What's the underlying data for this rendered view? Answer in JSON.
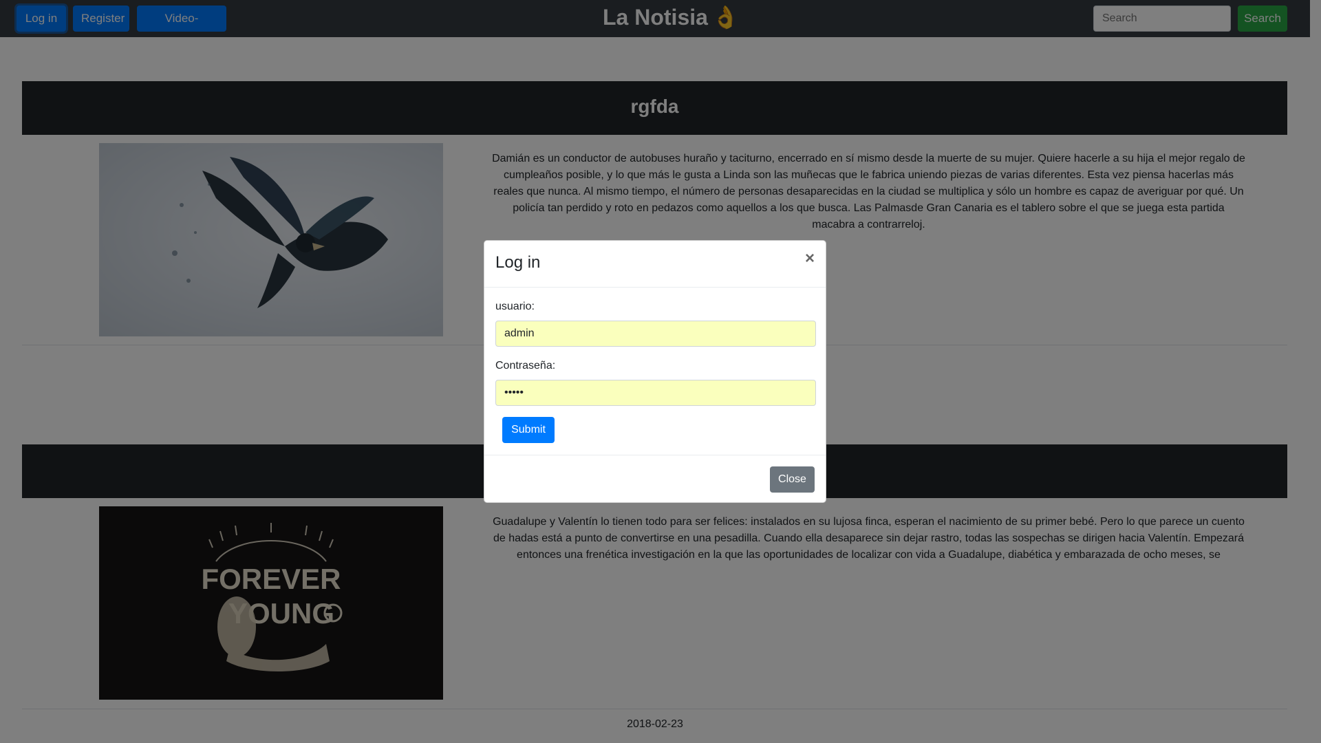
{
  "navbar": {
    "login_label": "Log in",
    "register_label": "Register",
    "video_label": "Video-Noticias",
    "brand": "La Notisia",
    "brand_emoji": "👌",
    "search_placeholder": "Search",
    "search_button": "Search"
  },
  "articles": [
    {
      "title": "rgfda",
      "image": "eagle-image",
      "text": "Damián es un conductor de autobuses huraño y taciturno, encerrado en sí mismo desde la muerte de su mujer. Quiere hacerle a su hija el mejor regalo de cumpleaños posible, y lo que más le gusta a Linda son las muñecas que le fabrica uniendo piezas de varias diferentes. Esta vez piensa hacerlas más reales que nunca. Al mismo tiempo, el número de personas desaparecidas en la ciudad se multiplica y sólo un hombre es capaz de averiguar por qué. Un policía tan perdido y roto en pedazos como aquellos a los que busca. Las Palmasde Gran Canaria es el tablero sobre el que se juega esta partida macabra a contrarreloj."
    },
    {
      "title": "",
      "image": "forever-young-image",
      "image_text_1": "FOREVER",
      "image_text_2": "YOUNG",
      "text": "Guadalupe y Valentín lo tienen todo para ser felices: instalados en su lujosa finca, esperan el nacimiento de su primer bebé. Pero lo que parece un cuento de hadas está a punto de convertirse en una pesadilla. Cuando ella desaparece sin dejar rastro, todas las sospechas se dirigen hacia Valentín. Empezará entonces una frenética investigación en la que las oportunidades de localizar con vida a Guadalupe, diabética y embarazada de ocho meses, se",
      "date": "2018-02-23"
    }
  ],
  "modal": {
    "title": "Log in",
    "close_x": "×",
    "user_label": "usuario:",
    "user_value": "admin",
    "password_label": "Contraseña:",
    "password_value": "•••••",
    "submit_label": "Submit",
    "close_label": "Close"
  },
  "colors": {
    "primary": "#007bff",
    "success": "#28a745",
    "secondary": "#6c757d",
    "dark": "#343a40",
    "autofill": "#faffbd"
  }
}
